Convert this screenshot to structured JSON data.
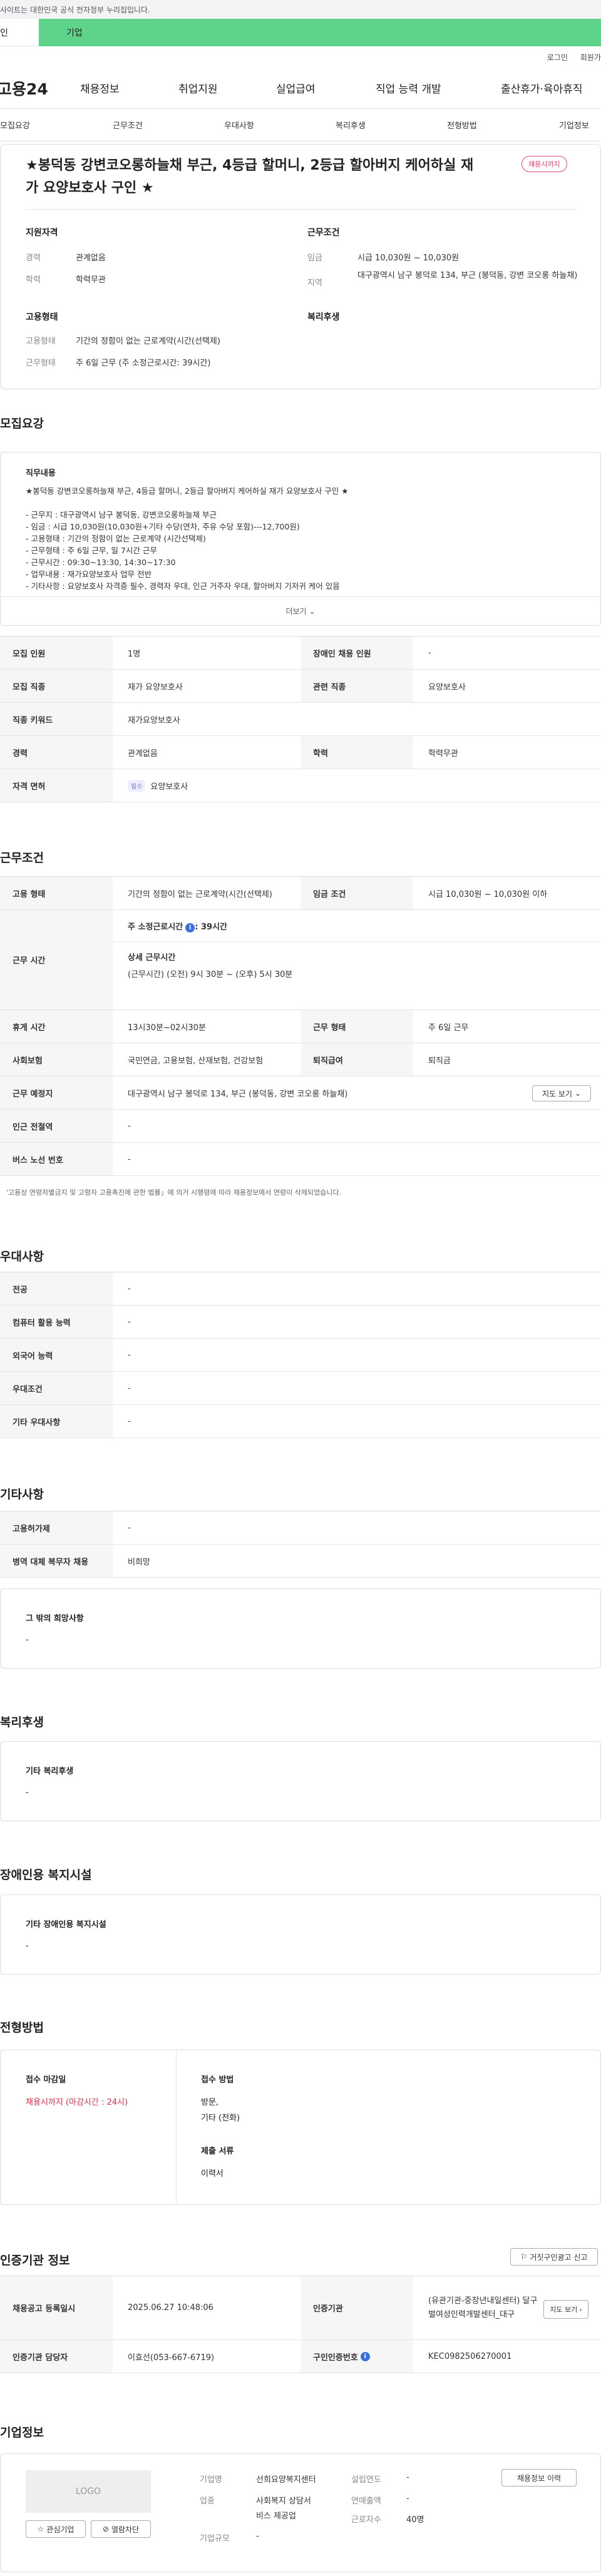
{
  "header": {
    "notice": "사이트는 대한민국 공식 전자정부 누리집입니다.",
    "user_tab_person": "인",
    "user_tab_company": "기업",
    "util_login": "로그인",
    "util_join": "회원가"
  },
  "gnb": {
    "logo": "고용24",
    "menus": [
      "채용정보",
      "취업지원",
      "실업급여",
      "직업 능력 개발",
      "출산휴가·육아휴직"
    ]
  },
  "tabs": [
    "모집요강",
    "근무조건",
    "우대사항",
    "복리후생",
    "전형방법",
    "기업정보"
  ],
  "summary": {
    "title": "★봉덕동 강변코오롱하늘채 부근, 4등급 할머니, 2등급 할아버지 케어하실 재가 요양보호사 구인 ★",
    "status_badge": "채용시까지",
    "qual_heading": "지원자격",
    "cond_heading": "근무조건",
    "career_label": "경력",
    "career_value": "관계없음",
    "edu_label": "학력",
    "edu_value": "학력무관",
    "wage_label": "임금",
    "wage_value": "시급 10,030원 ~ 10,030원",
    "region_label": "지역",
    "region_value": "대구광역시 남구 봉덕로 134, 부근 (봉덕동, 강변 코오롱 하늘채)",
    "employ_heading": "고용형태",
    "welfare_heading": "복리후생",
    "employ_type_label": "고용형태",
    "employ_type_value": "기간의 정함이 없는 근로계약(시간(선택제)",
    "work_form_label": "근무형태",
    "work_form_value": "주 6일 근무 (주 소정근로시간: 39시간)"
  },
  "recruit": {
    "heading": "모집요강",
    "duty_heading": "직무내용",
    "duty_lines": [
      "★봉덕동 강변코오롱하늘채 부근, 4등급 할머니, 2등급 할아버지 케어하실 재가 요양보호사 구인 ★",
      "",
      "- 근무지 : 대구광역시 남구 봉덕동, 강변코오롱하늘채 부근",
      "- 임금 : 시급 10,030원(10,030원+기타 수당(연차, 주유 수당 포함)---12,700원)",
      "- 고용형태 : 기간의 정함이 없는 근로계약 (시간선택제)",
      "- 근무형태 : 주 6일 근무, 일 7시간 근무",
      "- 근무시간 : 09:30~13:30, 14:30~17:30",
      "- 업무내용 : 재가요양보호사 업무 전반",
      "- 기타사항 : 요양보호사 자격증 필수, 경력자 우대, 인근 거주자 우대, 할아버지 기저귀 케어 있음"
    ],
    "more_label": "더보기",
    "rows": [
      {
        "th1": "모집 인원",
        "td1": "1명",
        "th2": "장애인 채용 인원",
        "td2": "-"
      },
      {
        "th1": "모집 직종",
        "td1": "재가 요양보호사",
        "th2": "관련 직종",
        "td2": "요양보호사"
      },
      {
        "th1": "직종 키워드",
        "td1": "재가요양보호사",
        "th2": "",
        "td2": ""
      },
      {
        "th1": "경력",
        "td1": "관계없음",
        "th2": "학력",
        "td2": "학력무관"
      }
    ],
    "license_th": "자격 면허",
    "license_tag": "필수",
    "license_value": "요양보호사"
  },
  "cond": {
    "heading": "근무조건",
    "employ_th": "고용 형태",
    "employ_td": "기간의 정함이 없는 근로계약(시간(선택제)",
    "wage_th": "임금 조건",
    "wage_td": "시급 10,030원 ~ 10,030원 이하",
    "time_th": "근무 시간",
    "time_line1": "주 소정근로시간",
    "time_line1_val": ": 39시간",
    "time_detail_heading": "상세 근무시간",
    "time_detail": "(근무시간) (오전) 9시 30분 ~ (오후) 5시 30분",
    "rest_th": "휴게 시간",
    "rest_td": "13시30분~02시30분",
    "form_th": "근무 형태",
    "form_td": "주 6일 근무",
    "ins_th": "사회보험",
    "ins_td": "국민연금, 고용보험, 산재보험, 건강보험",
    "sev_th": "퇴직급여",
    "sev_td": "퇴직금",
    "place_th": "근무 예정지",
    "place_td": "대구광역시 남구 봉덕로 134, 부근 (봉덕동, 강변 코오롱 하늘채)",
    "map_btn": "지도 보기",
    "subway_th": "인근 전철역",
    "subway_td": "-",
    "bus_th": "버스 노선 번호",
    "bus_td": "-",
    "note": "'고용상 연령차별금지 및 고령자 고용촉진에 관한 법률」에 의거 시행령에 따라 채용정보에서 연령이 삭제되었습니다."
  },
  "pref": {
    "heading": "우대사항",
    "rows": [
      {
        "th": "전공",
        "td": "-"
      },
      {
        "th": "컴퓨터 활용 능력",
        "td": "-"
      },
      {
        "th": "외국어 능력",
        "td": "-"
      },
      {
        "th": "우대조건",
        "td": "-"
      },
      {
        "th": "기타 우대사항",
        "td": "-"
      }
    ]
  },
  "etc": {
    "heading": "기타사항",
    "rows": [
      {
        "th": "고용허가제",
        "td": "-"
      },
      {
        "th": "병역 대체 복무자 채용",
        "td": "비희망"
      }
    ],
    "other_heading": "그 밖의 희망사항",
    "other_value": "-"
  },
  "welfare": {
    "heading": "복리후생",
    "sub_heading": "기타 복리후생",
    "value": "-"
  },
  "disabled": {
    "heading": "장애인용 복지시설",
    "sub_heading": "기타 장애인용 복지시설",
    "value": "-"
  },
  "process": {
    "heading": "전형방법",
    "deadline_heading": "접수 마감일",
    "deadline_value": "채용시까지 (마감시간 : 24시)",
    "method_heading": "접수 방법",
    "method_value1": "방문,",
    "method_value2": "기타 (전화)",
    "docs_heading": "제출 서류",
    "docs_value": "이력서"
  },
  "cert": {
    "heading": "인증기관 정보",
    "report_btn": "거짓구인광고 신고",
    "reg_th": "채용공고 등록일시",
    "reg_td": "2025.06.27 10:48:06",
    "agency_th": "인증기관",
    "agency_td": "(유관기관-중장년내일센터) 달구벌여성인력개발센터_대구",
    "map_btn": "지도 보기",
    "manager_th": "인증기관 담당자",
    "manager_td": "이효선(053-667-6719)",
    "id_th": "구인인증번호",
    "id_td": "KEC0982506270001"
  },
  "company": {
    "heading": "기업정보",
    "logo_text": "LOGO",
    "fav_btn": "관심기업",
    "block_btn": "열람차단",
    "name_label": "기업명",
    "name_value": "선희요양복지센터",
    "industry_label": "업종",
    "industry_value1": "사회복지 상담서",
    "industry_value2": "비스 제공업",
    "size_label": "기업규모",
    "size_value": "-",
    "founded_label": "설립연도",
    "founded_value": "-",
    "sales_label": "연매출액",
    "sales_value": "-",
    "employees_label": "근로자수",
    "employees_value": "40명",
    "history_btn": "채용정보 이력"
  }
}
